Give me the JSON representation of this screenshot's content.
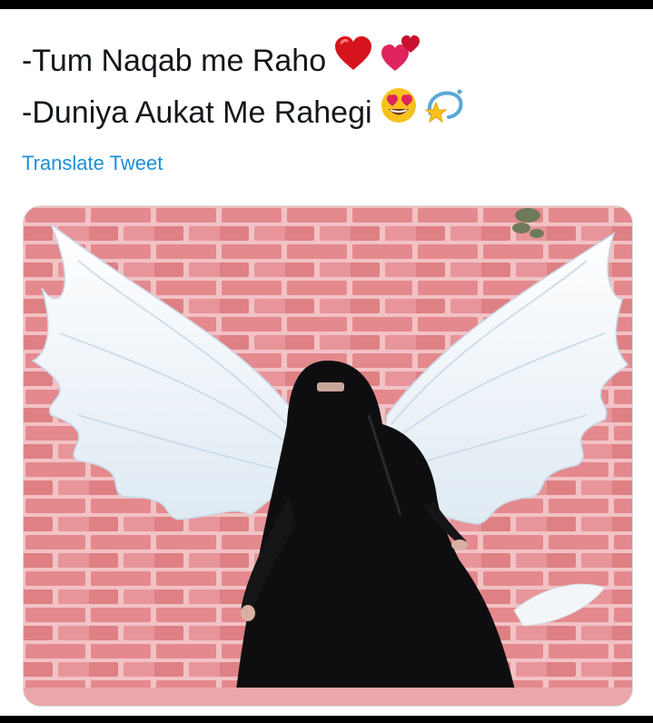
{
  "tweet": {
    "line1": "-Tum Naqab me Raho",
    "line2": "-Duniya Aukat Me Rahegi",
    "translate_label": "Translate Tweet"
  },
  "media": {
    "alt": "Woman in black niqab standing in front of painted angel wings on a pink brick wall"
  },
  "colors": {
    "text": "#14171a",
    "link": "#1b8fd6",
    "brick": "#e4898d",
    "mortar": "#f3c9cb",
    "wing": "#f4f8fb",
    "garment": "#0e0e10"
  },
  "icons": [
    "red-heart-icon",
    "two-hearts-icon",
    "heart-eyes-emoji-icon",
    "dizzy-star-icon"
  ]
}
